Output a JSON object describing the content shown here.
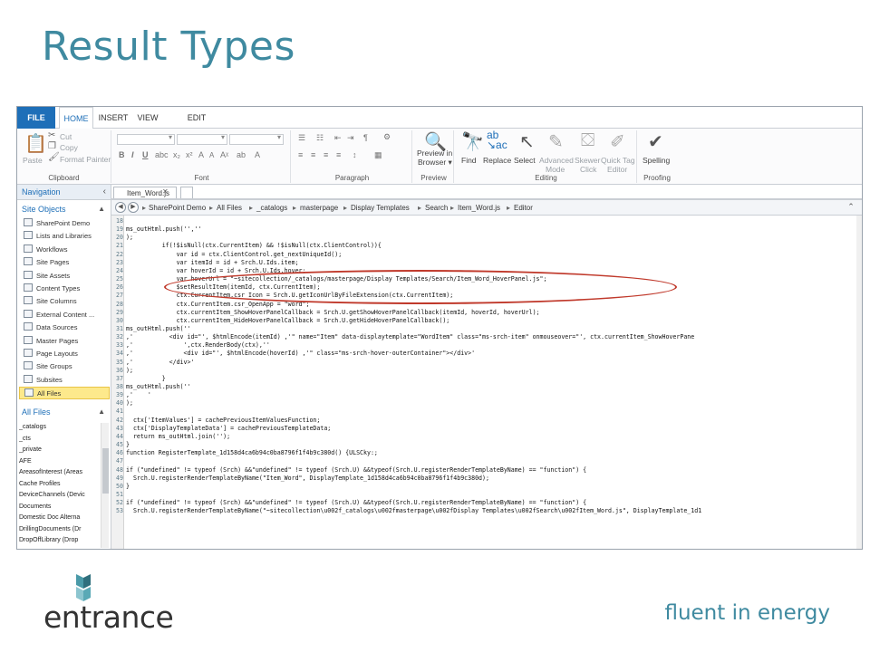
{
  "slide": {
    "title": "Result Types",
    "tagline": "fluent in energy",
    "logo_text": "entrance"
  },
  "ribbon": {
    "tabs": [
      "FILE",
      "HOME",
      "INSERT",
      "VIEW",
      "EDIT"
    ],
    "clipboard": {
      "paste": "Paste",
      "cut": "Cut",
      "copy": "Copy",
      "format_painter": "Format Painter",
      "label": "Clipboard"
    },
    "font": {
      "label": "Font"
    },
    "paragraph": {
      "label": "Paragraph"
    },
    "preview": {
      "button_line1": "Preview in",
      "button_line2": "Browser ▾",
      "label": "Preview"
    },
    "editing": {
      "find": "Find",
      "replace": "Replace",
      "select": "Select",
      "advanced_line1": "Advanced",
      "advanced_line2": "Mode",
      "skewer_line1": "Skewer",
      "skewer_line2": "Click",
      "quicktag_line1": "Quick Tag",
      "quicktag_line2": "Editor",
      "label": "Editing"
    },
    "proofing": {
      "spelling": "Spelling",
      "label": "Proofing"
    }
  },
  "nav": {
    "title": "Navigation",
    "site_objects_label": "Site Objects",
    "site_objects": [
      "SharePoint Demo",
      "Lists and Libraries",
      "Workflows",
      "Site Pages",
      "Site Assets",
      "Content Types",
      "Site Columns",
      "External Content ...",
      "Data Sources",
      "Master Pages",
      "Page Layouts",
      "Site Groups",
      "Subsites",
      "All Files"
    ],
    "all_files_label": "All Files",
    "libraries": [
      "_catalogs",
      "_cts",
      "_private",
      "AFE",
      "AreasofInterest (Areas",
      "Cache Profiles",
      "DeviceChannels (Devic",
      "Documents",
      "Domestic Doc Alterna",
      "DrillingDocuments (Dr",
      "DropOffLibrary (Drop"
    ]
  },
  "editor": {
    "tab_label": "Item_Word.js",
    "breadcrumbs": [
      "SharePoint Demo",
      "All Files",
      "_catalogs",
      "masterpage",
      "Display Templates",
      "Search",
      "Item_Word.js",
      "Editor"
    ],
    "lines": [
      {
        "n": "18",
        "t": ""
      },
      {
        "n": "19",
        "t": "ms_outHtml.push('',''"
      },
      {
        "n": "20",
        "t": ");"
      },
      {
        "n": "21",
        "t": "          if(!$isNull(ctx.CurrentItem) && !$isNull(ctx.ClientControl)){"
      },
      {
        "n": "22",
        "t": "              var id = ctx.ClientControl.get_nextUniqueId();"
      },
      {
        "n": "23",
        "t": "              var itemId = id + Srch.U.Ids.item;"
      },
      {
        "n": "24",
        "t": "              var hoverId = id + Srch.U.Ids.hover;"
      },
      {
        "n": "25",
        "t": "              var hoverUrl = \"~sitecollection/_catalogs/masterpage/Display Templates/Search/Item_Word_HoverPanel.js\";"
      },
      {
        "n": "26",
        "t": "              $setResultItem(itemId, ctx.CurrentItem);"
      },
      {
        "n": "27",
        "t": "              ctx.CurrentItem.csr_Icon = Srch.U.getIconUrlByFileExtension(ctx.CurrentItem);"
      },
      {
        "n": "28",
        "t": "              ctx.CurrentItem.csr_OpenApp = \"word\";"
      },
      {
        "n": "29",
        "t": "              ctx.currentItem_ShowHoverPanelCallback = Srch.U.getShowHoverPanelCallback(itemId, hoverId, hoverUrl);"
      },
      {
        "n": "30",
        "t": "              ctx.currentItem_HideHoverPanelCallback = Srch.U.getHideHoverPanelCallback();"
      },
      {
        "n": "31",
        "t": "ms_outHtml.push(''"
      },
      {
        "n": "32",
        "t": ",'          <div id=\"', $htmlEncode(itemId) ,'\" name=\"Item\" data-displaytemplate=\"WordItem\" class=\"ms-srch-item\" onmouseover=\"', ctx.currentItem_ShowHoverPane"
      },
      {
        "n": "33",
        "t": ",'              ',ctx.RenderBody(ctx),''"
      },
      {
        "n": "34",
        "t": ",'              <div id=\"', $htmlEncode(hoverId) ,'\" class=\"ms-srch-hover-outerContainer\"></div>'"
      },
      {
        "n": "35",
        "t": ",'          </div>'"
      },
      {
        "n": "36",
        "t": ");"
      },
      {
        "n": "37",
        "t": "          }"
      },
      {
        "n": "38",
        "t": "ms_outHtml.push(''"
      },
      {
        "n": "39",
        "t": ",'    '"
      },
      {
        "n": "40",
        "t": ");"
      },
      {
        "n": "41",
        "t": ""
      },
      {
        "n": "42",
        "t": "  ctx['ItemValues'] = cachePreviousItemValuesFunction;"
      },
      {
        "n": "43",
        "t": "  ctx['DisplayTemplateData'] = cachePreviousTemplateData;"
      },
      {
        "n": "44",
        "t": "  return ms_outHtml.join('');"
      },
      {
        "n": "45",
        "t": "}"
      },
      {
        "n": "46",
        "t": "function RegisterTemplate_1d158d4ca6b94c0ba8796f1f4b9c380d() {ULSCky:;"
      },
      {
        "n": "47",
        "t": ""
      },
      {
        "n": "48",
        "t": "if (\"undefined\" != typeof (Srch) &&\"undefined\" != typeof (Srch.U) &&typeof(Srch.U.registerRenderTemplateByName) == \"function\") {"
      },
      {
        "n": "49",
        "t": "  Srch.U.registerRenderTemplateByName(\"Item_Word\", DisplayTemplate_1d158d4ca6b94c0ba8796f1f4b9c380d);"
      },
      {
        "n": "50",
        "t": "}"
      },
      {
        "n": "51",
        "t": ""
      },
      {
        "n": "52",
        "t": "if (\"undefined\" != typeof (Srch) &&\"undefined\" != typeof (Srch.U) &&typeof(Srch.U.registerRenderTemplateByName) == \"function\") {"
      },
      {
        "n": "53",
        "t": "  Srch.U.registerRenderTemplateByName(\"~sitecollection\\u002f_catalogs\\u002fmasterpage\\u002fDisplay Templates\\u002fSearch\\u002fItem_Word.js\", DisplayTemplate_1d1"
      }
    ]
  },
  "colors": {
    "accent": "#3f8aa0",
    "file_tab": "#1e6fb8",
    "highlight": "#c0392b",
    "selected_nav": "#fde98c"
  }
}
